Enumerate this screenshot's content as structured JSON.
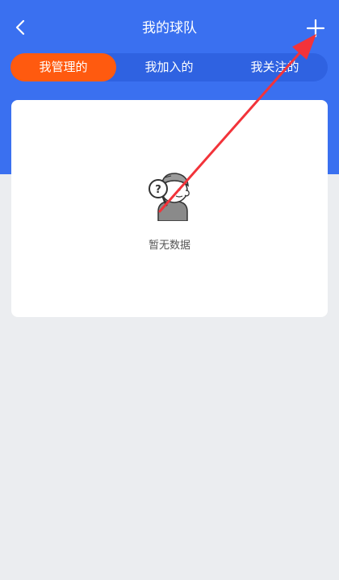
{
  "header": {
    "title": "我的球队"
  },
  "tabs": [
    {
      "label": "我管理的",
      "active": true
    },
    {
      "label": "我加入的",
      "active": false
    },
    {
      "label": "我关注的",
      "active": false
    }
  ],
  "empty_state": {
    "text": "暂无数据"
  },
  "colors": {
    "primary_blue": "#3a70f0",
    "tab_bar_blue": "#2f62e1",
    "active_orange": "#ff5a0f",
    "background": "#ebedf0",
    "annotation_red": "#f2333a"
  },
  "icons": {
    "back": "chevron-left-icon",
    "add": "plus-icon",
    "empty": "confused-boy-magnifier-icon"
  }
}
